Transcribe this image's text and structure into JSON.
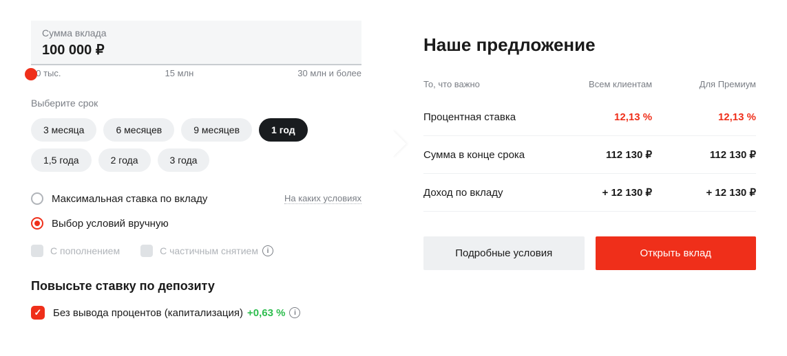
{
  "amount": {
    "label": "Сумма вклада",
    "value": "100 000 ₽"
  },
  "slider": {
    "min": "10 тыс.",
    "mid": "15 млн",
    "max": "30 млн и более"
  },
  "term": {
    "label": "Выберите срок",
    "options": [
      "3 месяца",
      "6 месяцев",
      "9 месяцев",
      "1 год",
      "1,5 года",
      "2 года",
      "3 года"
    ],
    "selected": "1 год"
  },
  "radios": {
    "maxRate": "Максимальная ставка по вкладу",
    "manual": "Выбор условий вручную",
    "conditionsLink": "На каких условиях"
  },
  "checkboxes": {
    "replenish": "С пополнением",
    "partial": "С частичным снятием"
  },
  "boost": {
    "title": "Повысьте ставку по депозиту",
    "capitalization": "Без вывода процентов (капитализация)",
    "bonus": "+0,63 %"
  },
  "offer": {
    "title": "Наше предложение",
    "colImportant": "То, что важно",
    "colAll": "Всем клиентам",
    "colPremium": "Для Премиум",
    "rows": [
      {
        "label": "Процентная ставка",
        "all": "12,13 %",
        "premium": "12,13 %",
        "highlight": true
      },
      {
        "label": "Сумма в конце срока",
        "all": "112 130 ₽",
        "premium": "112 130 ₽",
        "highlight": false
      },
      {
        "label": "Доход по вкладу",
        "all": "+ 12 130 ₽",
        "premium": "+ 12 130 ₽",
        "highlight": false
      }
    ],
    "btnDetails": "Подробные условия",
    "btnOpen": "Открыть вклад"
  }
}
